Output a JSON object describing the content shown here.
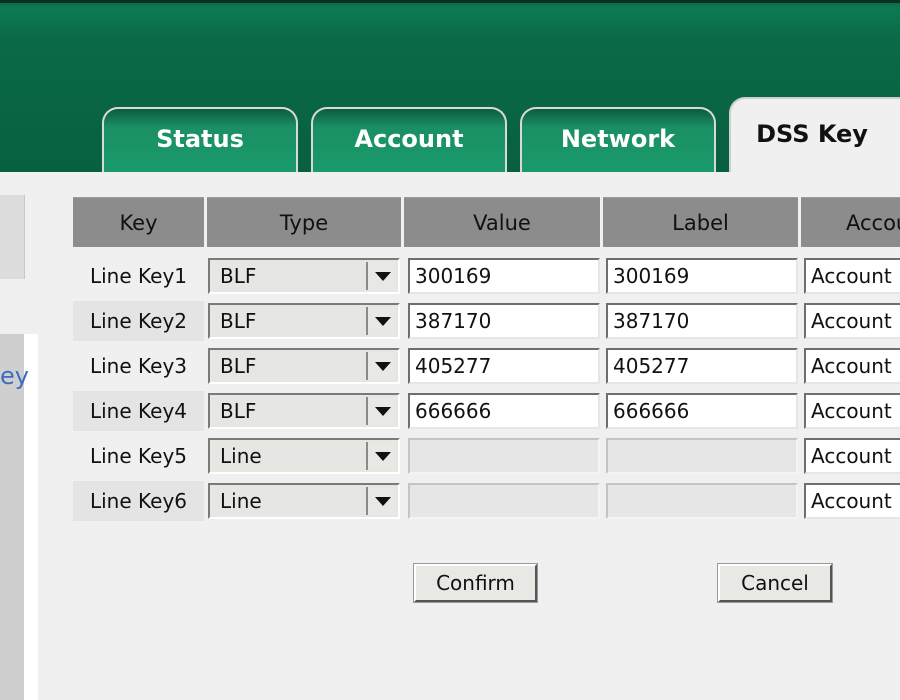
{
  "tabs": [
    {
      "label": "Status",
      "active": false
    },
    {
      "label": "Account",
      "active": false
    },
    {
      "label": "Network",
      "active": false
    },
    {
      "label": "DSS Key",
      "active": true
    }
  ],
  "sidebar": {
    "partial_text": "ey"
  },
  "table": {
    "headers": [
      "Key",
      "Type",
      "Value",
      "Label",
      "Accou"
    ],
    "rows": [
      {
        "key": "Line Key1",
        "type": "BLF",
        "value": "300169",
        "label": "300169",
        "account": "Account",
        "disabled": false
      },
      {
        "key": "Line Key2",
        "type": "BLF",
        "value": "387170",
        "label": "387170",
        "account": "Account",
        "disabled": false
      },
      {
        "key": "Line Key3",
        "type": "BLF",
        "value": "405277",
        "label": "405277",
        "account": "Account",
        "disabled": false
      },
      {
        "key": "Line Key4",
        "type": "BLF",
        "value": "666666",
        "label": "666666",
        "account": "Account",
        "disabled": false
      },
      {
        "key": "Line Key5",
        "type": "Line",
        "value": "",
        "label": "",
        "account": "Account",
        "disabled": true
      },
      {
        "key": "Line Key6",
        "type": "Line",
        "value": "",
        "label": "",
        "account": "Account",
        "disabled": true
      }
    ]
  },
  "buttons": {
    "confirm": "Confirm",
    "cancel": "Cancel"
  }
}
